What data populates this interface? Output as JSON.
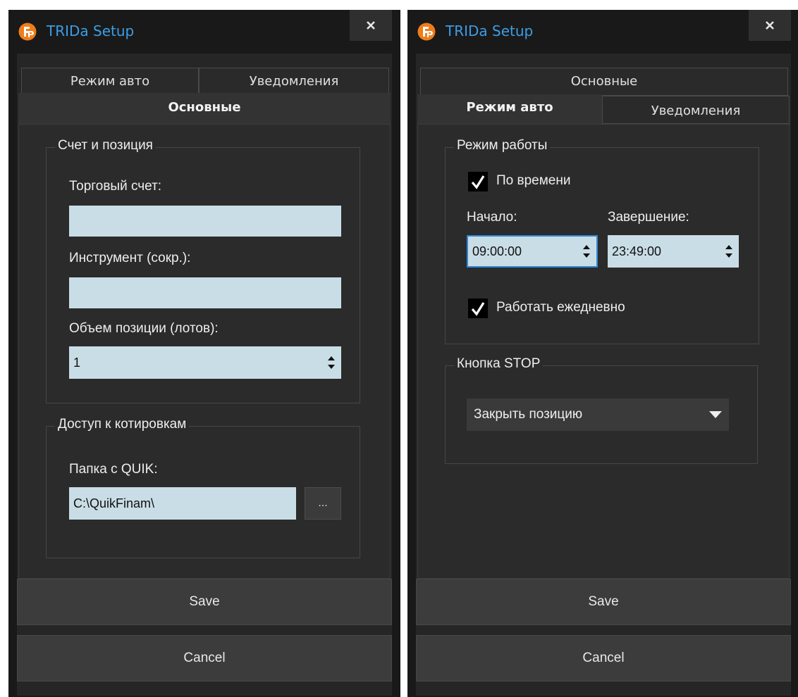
{
  "left": {
    "title": "TRIDa Setup",
    "tabs": {
      "auto": "Режим авто",
      "notifications": "Уведомления",
      "main": "Основные"
    },
    "account_group": {
      "title": "Счет и позиция",
      "trade_account_label": "Торговый счет:",
      "trade_account_value": "",
      "instrument_label": "Инструмент (сокр.):",
      "instrument_value": "",
      "volume_label": "Объем позиции (лотов):",
      "volume_value": "1"
    },
    "quotes_group": {
      "title": "Доступ к котировкам",
      "quik_folder_label": "Папка с QUIK:",
      "quik_folder_value": "C:\\QuikFinam\\",
      "browse_label": "..."
    },
    "save_label": "Save",
    "cancel_label": "Cancel"
  },
  "right": {
    "title": "TRIDa Setup",
    "tabs": {
      "main": "Основные",
      "auto": "Режим авто",
      "notifications": "Уведомления"
    },
    "mode_group": {
      "title": "Режим работы",
      "by_time_label": "По времени",
      "by_time_checked": true,
      "start_label": "Начало:",
      "start_value": "09:00:00",
      "end_label": "Завершение:",
      "end_value": "23:49:00",
      "daily_label": "Работать ежедневно",
      "daily_checked": true
    },
    "stop_group": {
      "title": "Кнопка STOP",
      "selected_option": "Закрыть позицию"
    },
    "save_label": "Save",
    "cancel_label": "Cancel"
  },
  "colors": {
    "title_text": "#3c9ee6",
    "logo_orange": "#ef7d1a",
    "input_bg": "#c9dde6",
    "focus_border": "#2f87d8",
    "window_bg": "#191919"
  }
}
